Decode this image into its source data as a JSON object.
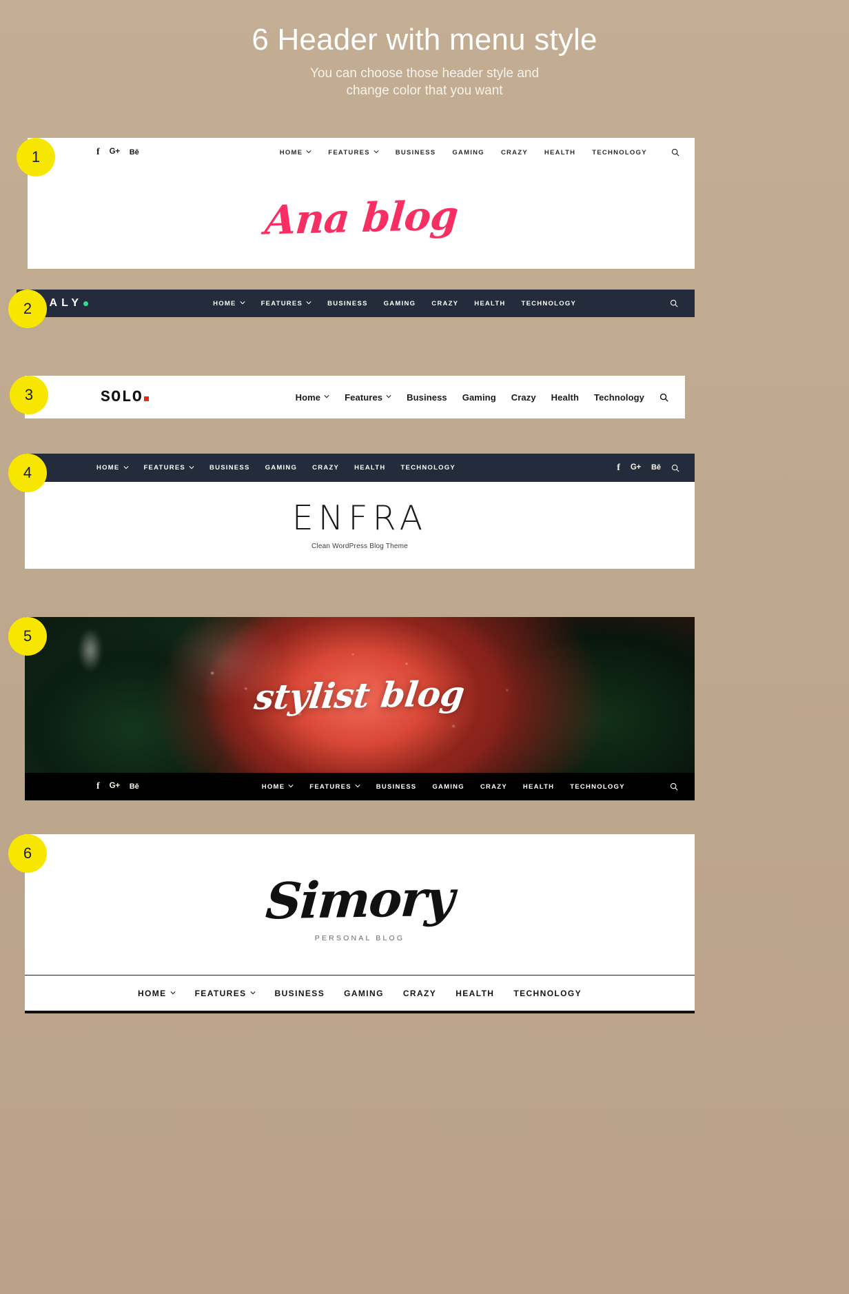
{
  "page": {
    "title": "6 Header with menu style",
    "subtitle_line1": "You can choose those header style and",
    "subtitle_line2": "change color that you want",
    "background_color": "#c0a98f",
    "badge_color": "#f7e600"
  },
  "icons": {
    "facebook": "f",
    "google_plus": "G+",
    "behance": "Bē",
    "search": "search-icon",
    "caret": "chevron-down-icon"
  },
  "nav_uppercase": [
    {
      "label": "HOME",
      "has_caret": true
    },
    {
      "label": "FEATURES",
      "has_caret": true
    },
    {
      "label": "BUSINESS",
      "has_caret": false
    },
    {
      "label": "GAMING",
      "has_caret": false
    },
    {
      "label": "CRAZY",
      "has_caret": false
    },
    {
      "label": "HEALTH",
      "has_caret": false
    },
    {
      "label": "TECHNOLOGY",
      "has_caret": false
    }
  ],
  "nav_titlecase": [
    {
      "label": "Home",
      "has_caret": true
    },
    {
      "label": "Features",
      "has_caret": true
    },
    {
      "label": "Business",
      "has_caret": false
    },
    {
      "label": "Gaming",
      "has_caret": false
    },
    {
      "label": "Crazy",
      "has_caret": false
    },
    {
      "label": "Health",
      "has_caret": false
    },
    {
      "label": "Technology",
      "has_caret": false
    }
  ],
  "headers": [
    {
      "number": "1",
      "logo": "Ana blog",
      "logo_color": "#f72f63",
      "bar_color": "#ffffff",
      "nav_style": "uppercase-light",
      "has_socials": true,
      "has_search": true
    },
    {
      "number": "2",
      "logo": "DALY",
      "logo_dot_color": "#2fe08a",
      "bar_color": "#242c3b",
      "nav_style": "uppercase-dark",
      "has_socials": false,
      "has_search": true
    },
    {
      "number": "3",
      "logo": "SOLO",
      "logo_dot_color": "#f02613",
      "bar_color": "#ffffff",
      "nav_style": "titlecase-light",
      "has_socials": false,
      "has_search": true
    },
    {
      "number": "4",
      "logo": "ENFRA",
      "tagline": "Clean WordPress Blog Theme",
      "bar_color": "#242c3b",
      "nav_style": "uppercase-dark",
      "has_socials": true,
      "has_search": true
    },
    {
      "number": "5",
      "logo": "stylist blog",
      "logo_color": "#ffffff",
      "bar_color": "#000000",
      "nav_style": "uppercase-dark",
      "has_socials": true,
      "has_search": true
    },
    {
      "number": "6",
      "logo": "Simory",
      "tagline": "PERSONAL  BLOG",
      "bar_color": "#ffffff",
      "nav_style": "uppercase-light",
      "has_socials": false,
      "has_search": false
    }
  ]
}
